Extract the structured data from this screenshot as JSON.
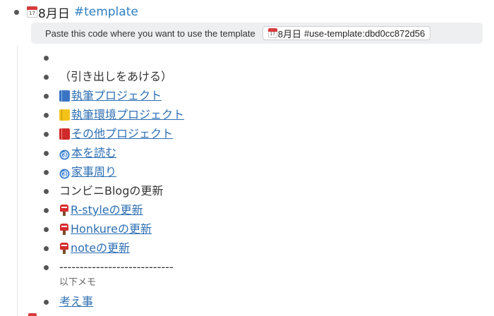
{
  "page": {
    "title_date": "8月日",
    "calendar_icon_day": "17",
    "title_hashtag": "#template"
  },
  "template_box": {
    "hint": "Paste this code where you want to use the template",
    "code_date": "8月日",
    "code_text": "#use-template:dbd0cc872d56"
  },
  "items": [
    {
      "text": "",
      "icon": null,
      "link": false
    },
    {
      "text": "（引き出しをあける）",
      "icon": null,
      "link": false
    },
    {
      "text": "執筆プロジェクト",
      "icon": "blue-book-icon",
      "link": true
    },
    {
      "text": "執筆環境プロジェクト",
      "icon": "yellow-book-icon",
      "link": true
    },
    {
      "text": "その他プロジェクト",
      "icon": "red-book-icon",
      "link": true
    },
    {
      "text": "本を読む",
      "icon": "cyclone-icon",
      "link": true
    },
    {
      "text": "家事周り",
      "icon": "cyclone-icon",
      "link": true
    },
    {
      "text": "コンビニBlogの更新",
      "icon": null,
      "link": false
    },
    {
      "text": "R-styleの更新",
      "icon": "postbox-icon",
      "link": true
    },
    {
      "text": "Honkureの更新",
      "icon": "postbox-icon",
      "link": true
    },
    {
      "text": "noteの更新",
      "icon": "postbox-icon",
      "link": true
    },
    {
      "text": "----------------------------",
      "icon": null,
      "link": false
    },
    {
      "text": "考え事",
      "icon": null,
      "link": true
    }
  ],
  "memo_note": "以下メモ",
  "colors": {
    "link": "#2d6fb3",
    "hashtag": "#2d7fc1",
    "template_bg": "#eeeff1",
    "bullet": "#555555"
  }
}
